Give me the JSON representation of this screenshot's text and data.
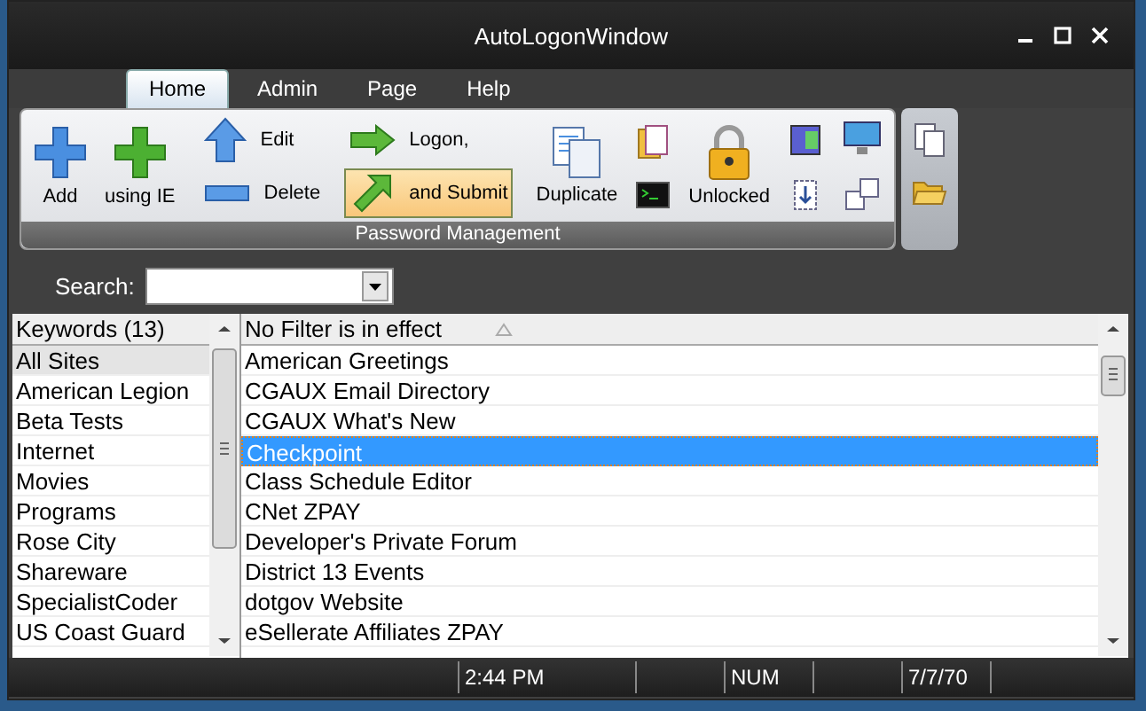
{
  "window": {
    "title": "AutoLogonWindow"
  },
  "tabs": [
    {
      "label": "Home",
      "selected": true
    },
    {
      "label": "Admin",
      "selected": false
    },
    {
      "label": "Page",
      "selected": false
    },
    {
      "label": "Help",
      "selected": false
    }
  ],
  "ribbon": {
    "group_label": "Password Management",
    "buttons": [
      {
        "label": "Add",
        "highlighted": false
      },
      {
        "label": "using IE",
        "highlighted": false
      },
      {
        "label": "Edit",
        "highlighted": false
      },
      {
        "label": "Delete",
        "highlighted": false
      },
      {
        "label": "Logon,",
        "highlighted": false
      },
      {
        "label": "and Submit",
        "highlighted": true
      },
      {
        "label": "Duplicate",
        "highlighted": false
      },
      {
        "label": "Unlocked",
        "highlighted": false
      }
    ]
  },
  "search": {
    "label": "Search:"
  },
  "keywords": {
    "header": "Keywords (13)",
    "items": [
      {
        "label": "All Sites",
        "selected": true
      },
      {
        "label": "American Legion",
        "selected": false
      },
      {
        "label": "Beta Tests",
        "selected": false
      },
      {
        "label": "Internet",
        "selected": false
      },
      {
        "label": "Movies",
        "selected": false
      },
      {
        "label": "Programs",
        "selected": false
      },
      {
        "label": "Rose City",
        "selected": false
      },
      {
        "label": "Shareware",
        "selected": false
      },
      {
        "label": "SpecialistCoder",
        "selected": false
      },
      {
        "label": "US Coast Guard",
        "selected": false
      }
    ]
  },
  "sites": {
    "header": "No Filter is in effect",
    "rows": [
      {
        "label": "American Greetings",
        "selected": false
      },
      {
        "label": "CGAUX Email Directory",
        "selected": false
      },
      {
        "label": "CGAUX What's New",
        "selected": false
      },
      {
        "label": "Checkpoint",
        "selected": true
      },
      {
        "label": "Class Schedule Editor",
        "selected": false
      },
      {
        "label": "CNet ZPAY",
        "selected": false
      },
      {
        "label": "Developer's Private Forum",
        "selected": false
      },
      {
        "label": "District 13 Events",
        "selected": false
      },
      {
        "label": "dotgov Website",
        "selected": false
      },
      {
        "label": "eSellerate Affiliates ZPAY",
        "selected": false
      }
    ]
  },
  "status_bar": {
    "time": "2:44 PM",
    "num_lock": "NUM",
    "date": "7/7/70"
  }
}
